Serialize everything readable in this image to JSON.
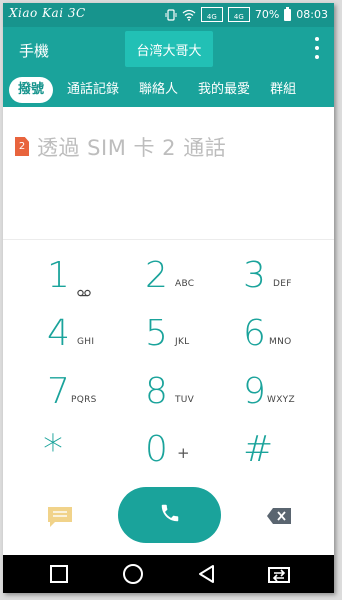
{
  "watermark": "Xiao Kai 3C",
  "status": {
    "battery": "70%",
    "time": "08:03",
    "signal1": "4G",
    "signal2": "4G"
  },
  "header": {
    "title": "手機",
    "sim_label": "台湾大哥大"
  },
  "tabs": [
    {
      "label": "撥號",
      "active": true
    },
    {
      "label": "通話記錄"
    },
    {
      "label": "聯絡人"
    },
    {
      "label": "我的最愛"
    },
    {
      "label": "群組"
    }
  ],
  "display": {
    "sim_number": "2",
    "hint": "透過 SIM 卡 2 通話"
  },
  "keypad": [
    {
      "digit": "1",
      "letters": ""
    },
    {
      "digit": "2",
      "letters": "ABC"
    },
    {
      "digit": "3",
      "letters": "DEF"
    },
    {
      "digit": "4",
      "letters": "GHI"
    },
    {
      "digit": "5",
      "letters": "JKL"
    },
    {
      "digit": "6",
      "letters": "MNO"
    },
    {
      "digit": "7",
      "letters": "PQRS"
    },
    {
      "digit": "8",
      "letters": "TUV"
    },
    {
      "digit": "9",
      "letters": "WXYZ"
    },
    {
      "digit": "*",
      "letters": ""
    },
    {
      "digit": "0",
      "letters": "+"
    },
    {
      "digit": "#",
      "letters": ""
    }
  ],
  "colors": {
    "accent": "#1aa39b",
    "status_bar": "#17948d",
    "sim_badge": "#e8643d"
  },
  "icons": [
    "voicemail-icon",
    "message-icon",
    "phone-icon",
    "backspace-icon",
    "nav-recents-icon",
    "nav-home-icon",
    "nav-back-icon",
    "nav-dual-window-icon",
    "more-options-icon"
  ]
}
